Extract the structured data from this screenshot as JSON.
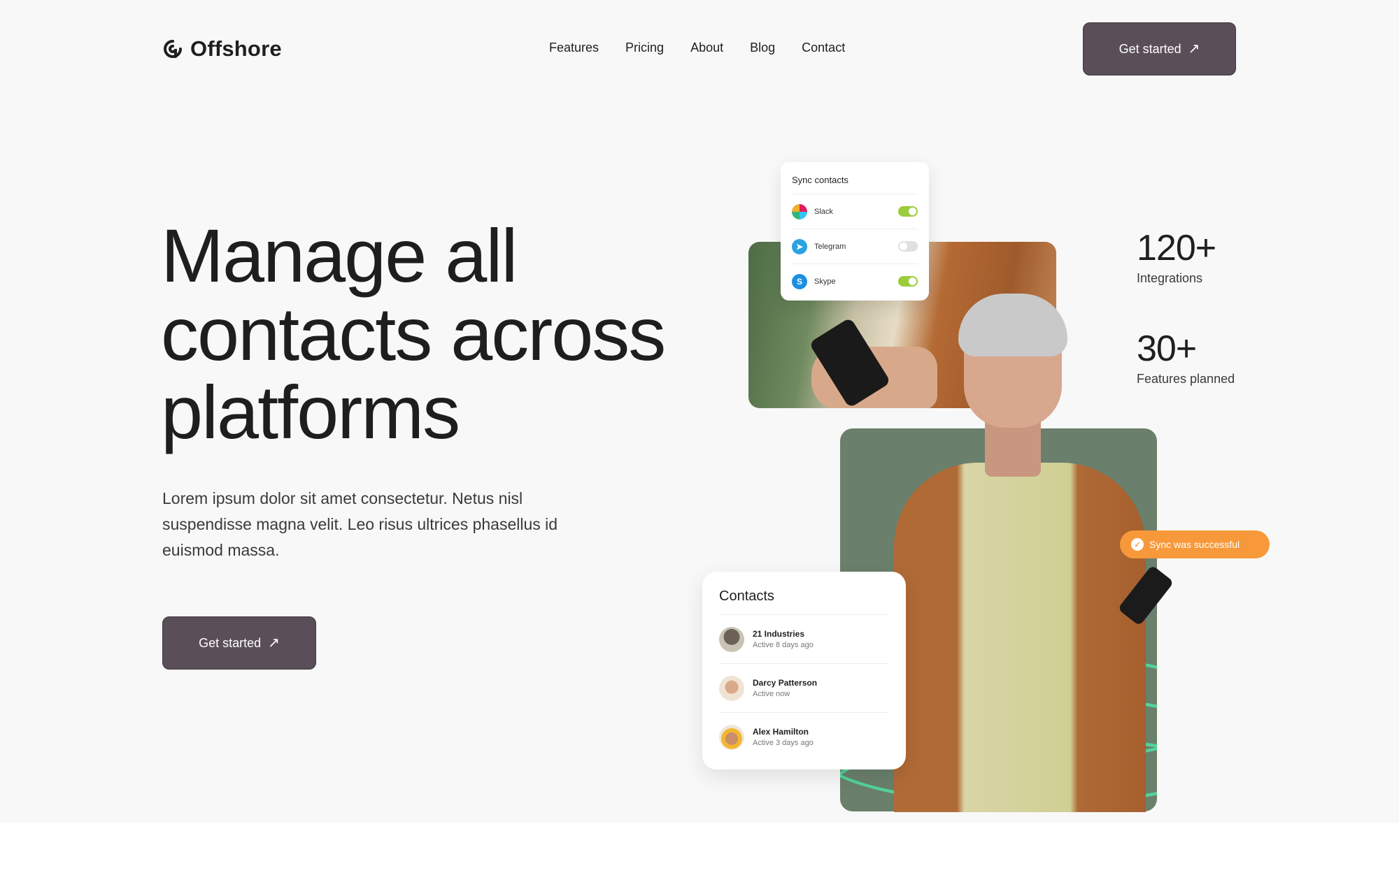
{
  "header": {
    "logo_text": "Offshore",
    "nav": [
      "Features",
      "Pricing",
      "About",
      "Blog",
      "Contact"
    ],
    "cta_label": "Get started"
  },
  "hero": {
    "title_lines": [
      "Manage all",
      "contacts across",
      "platforms"
    ],
    "subtitle": "Lorem ipsum dolor sit amet consectetur. Netus nisl suspendisse magna velit. Leo risus ultrices phasellus id euismod massa.",
    "cta_label": "Get started"
  },
  "sync_card": {
    "title": "Sync contacts",
    "apps": [
      {
        "name": "Slack",
        "enabled": true,
        "icon": "slack-icon"
      },
      {
        "name": "Telegram",
        "enabled": false,
        "icon": "telegram-icon"
      },
      {
        "name": "Skype",
        "enabled": true,
        "icon": "skype-icon"
      }
    ]
  },
  "stats": [
    {
      "value": "120+",
      "label": "Integrations"
    },
    {
      "value": "30+",
      "label": "Features planned"
    }
  ],
  "badge": {
    "label": "Sync was successful",
    "icon": "check-icon"
  },
  "contacts_card": {
    "title": "Contacts",
    "items": [
      {
        "name": "21 Industries",
        "status": "Active 8 days ago"
      },
      {
        "name": "Darcy Patterson",
        "status": "Active now"
      },
      {
        "name": "Alex Hamilton",
        "status": "Active 3 days ago"
      }
    ]
  },
  "colors": {
    "primary_button": "#5a4f58",
    "badge_orange": "#f7993a",
    "toggle_on": "#9ccc3c",
    "panel_green": "#6a7f6c"
  }
}
